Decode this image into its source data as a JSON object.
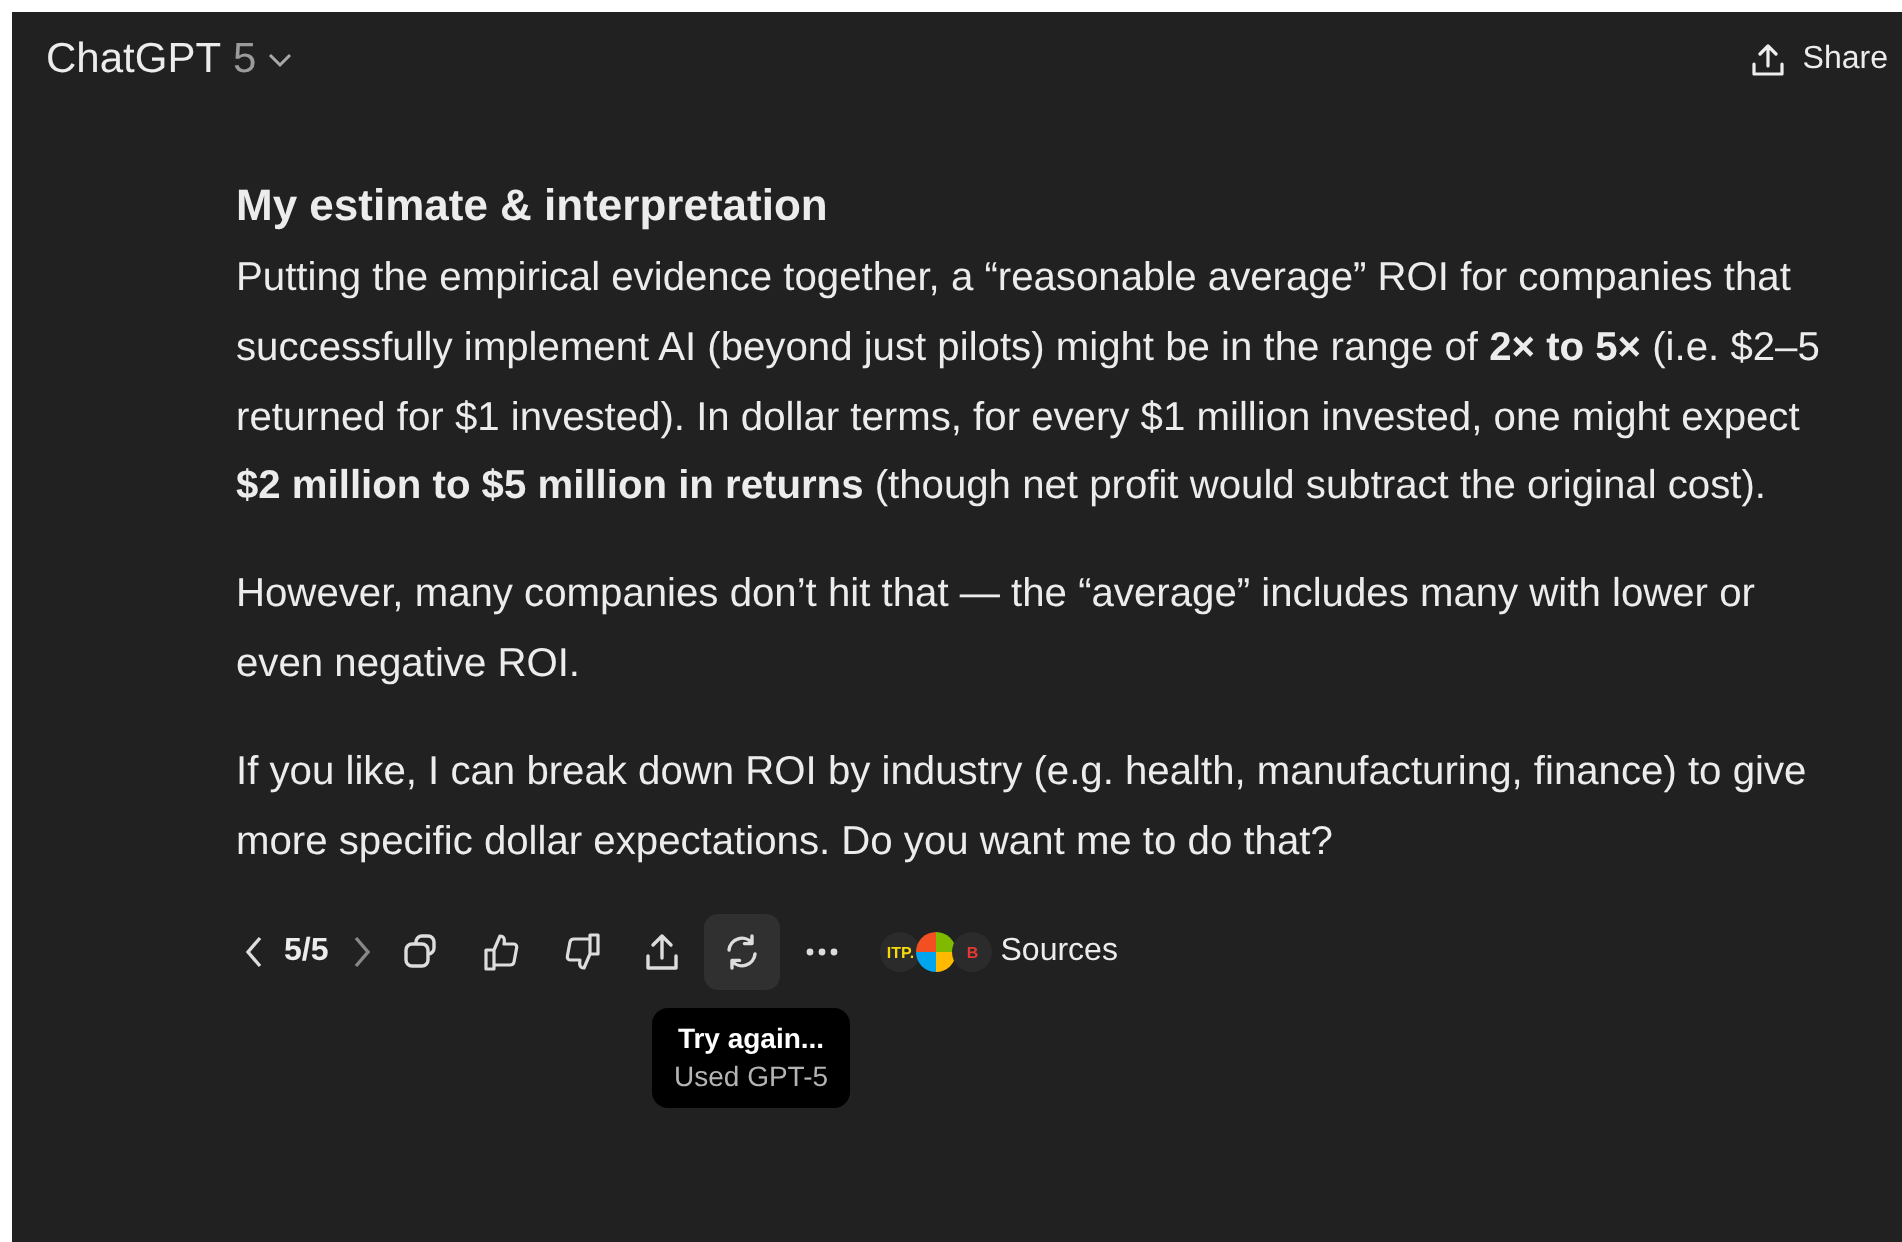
{
  "header": {
    "title": "ChatGPT",
    "model": "5",
    "share": "Share"
  },
  "message": {
    "heading": "My estimate & interpretation",
    "paragraphs": [
      "Putting the empirical evidence together, a “reasonable average” ROI for companies that successfully implement AI (beyond just pilots) might be in the range of **2× to 5×** (i.e. $2–5 returned for $1 invested). In dollar terms, for every $1 million invested, one might expect **$2 million to $5 million in returns** (though net profit would subtract the original cost).",
      "However, many companies don’t hit that — the “average” includes many with lower or even negative ROI.",
      "If you like, I can break down ROI by industry (e.g. health, manufacturing, finance) to give more specific dollar expectations. Do you want me to do that?"
    ]
  },
  "actions": {
    "pager": "5/5",
    "buttons": [
      {
        "kind": "copy",
        "highlighted": false
      },
      {
        "kind": "like",
        "highlighted": false
      },
      {
        "kind": "dislike",
        "highlighted": false
      },
      {
        "kind": "share",
        "highlighted": false
      },
      {
        "kind": "retry",
        "highlighted": true
      },
      {
        "kind": "more",
        "highlighted": false
      }
    ],
    "source_badges": [
      {
        "kind": "text",
        "label": "ITP.",
        "color": "#f5d90a"
      },
      {
        "kind": "windows"
      },
      {
        "kind": "text",
        "label": "B",
        "color": "#e53935"
      }
    ],
    "sources": "Sources"
  },
  "tooltip": {
    "title": "Try again...",
    "subtitle": "Used GPT-5"
  }
}
